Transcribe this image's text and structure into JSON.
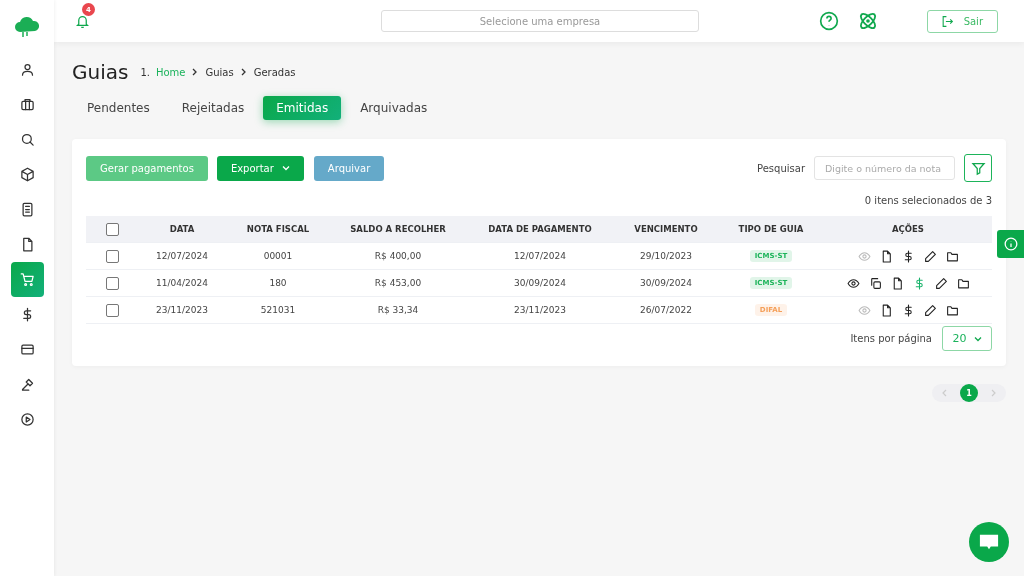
{
  "sidebar": {
    "items": [
      {
        "kind": "user",
        "selected": false
      },
      {
        "kind": "briefcase",
        "selected": false
      },
      {
        "kind": "search",
        "selected": false
      },
      {
        "kind": "box",
        "selected": false
      },
      {
        "kind": "calculator",
        "selected": false
      },
      {
        "kind": "file",
        "selected": false
      },
      {
        "kind": "cart",
        "selected": true
      },
      {
        "kind": "dollar",
        "selected": false
      },
      {
        "kind": "card",
        "selected": false
      },
      {
        "kind": "gavel",
        "selected": false
      },
      {
        "kind": "play",
        "selected": false
      }
    ]
  },
  "topbar": {
    "notifications": "4",
    "company_select": {
      "placeholder": "Selecione uma empresa"
    },
    "logout": "Sair"
  },
  "page": {
    "title": "Guias",
    "breadcrumb": [
      {
        "label": "1.",
        "kind": "number"
      },
      {
        "label": "Home",
        "kind": "link"
      },
      {
        "label": "Guias",
        "kind": "text"
      },
      {
        "label": "Geradas",
        "kind": "text"
      }
    ]
  },
  "tabs": [
    {
      "label": "Pendentes",
      "selected": false
    },
    {
      "label": "Rejeitadas",
      "selected": false
    },
    {
      "label": "Emitidas",
      "selected": true
    },
    {
      "label": "Arquivadas",
      "selected": false
    }
  ],
  "toolbar": {
    "buttons": [
      {
        "label": "Gerar pagamentos",
        "kind": "light"
      },
      {
        "label": "Exportar",
        "kind": "dropdown"
      },
      {
        "label": "Arquivar",
        "kind": "blue"
      }
    ],
    "search_label": "Pesquisar",
    "search": {
      "placeholder": "Digite o número da nota"
    }
  },
  "selection_info": "0 itens selecionados de 3",
  "table": {
    "columns": [
      "DATA",
      "NOTA FISCAL",
      "SALDO A RECOLHER",
      "DATA DE PAGAMENTO",
      "VENCIMENTO",
      "TIPO DE GUIA",
      "AÇÕES"
    ],
    "select_all": {
      "checked": false
    },
    "rows": [
      {
        "checked": false,
        "cells": [
          "12/07/2024",
          "00001",
          "R$ 400,00",
          "12/07/2024",
          "29/10/2023"
        ],
        "type": {
          "label": "ICMS-ST",
          "color": "#1db45a"
        },
        "actions": [
          {
            "kind": "view",
            "disabled": true,
            "active": false
          },
          {
            "kind": "file",
            "disabled": false,
            "active": false
          },
          {
            "kind": "dollar",
            "disabled": false,
            "active": false
          },
          {
            "kind": "edit",
            "disabled": false,
            "active": false
          },
          {
            "kind": "folder",
            "disabled": false,
            "active": false
          }
        ]
      },
      {
        "checked": false,
        "cells": [
          "11/04/2024",
          "180",
          "R$ 453,00",
          "30/09/2024",
          "30/09/2024"
        ],
        "type": {
          "label": "ICMS-ST",
          "color": "#1db45a"
        },
        "actions": [
          {
            "kind": "view",
            "disabled": false,
            "active": false
          },
          {
            "kind": "copy",
            "disabled": false,
            "active": false
          },
          {
            "kind": "file",
            "disabled": false,
            "active": false
          },
          {
            "kind": "dollar",
            "disabled": false,
            "active": true
          },
          {
            "kind": "edit",
            "disabled": false,
            "active": false
          },
          {
            "kind": "folder",
            "disabled": false,
            "active": false
          }
        ]
      },
      {
        "checked": false,
        "cells": [
          "23/11/2023",
          "521031",
          "R$ 33,34",
          "23/11/2023",
          "26/07/2022"
        ],
        "type": {
          "label": "DIFAL",
          "color": "#f5a05a"
        },
        "actions": [
          {
            "kind": "view",
            "disabled": true,
            "active": false
          },
          {
            "kind": "file",
            "disabled": false,
            "active": false
          },
          {
            "kind": "dollar",
            "disabled": false,
            "active": false
          },
          {
            "kind": "edit",
            "disabled": false,
            "active": false
          },
          {
            "kind": "folder",
            "disabled": false,
            "active": false
          }
        ]
      }
    ]
  },
  "page_size": {
    "label": "Itens por página",
    "value": "20"
  },
  "pagination": {
    "pages": [
      {
        "label": "1",
        "selected": true
      }
    ]
  }
}
